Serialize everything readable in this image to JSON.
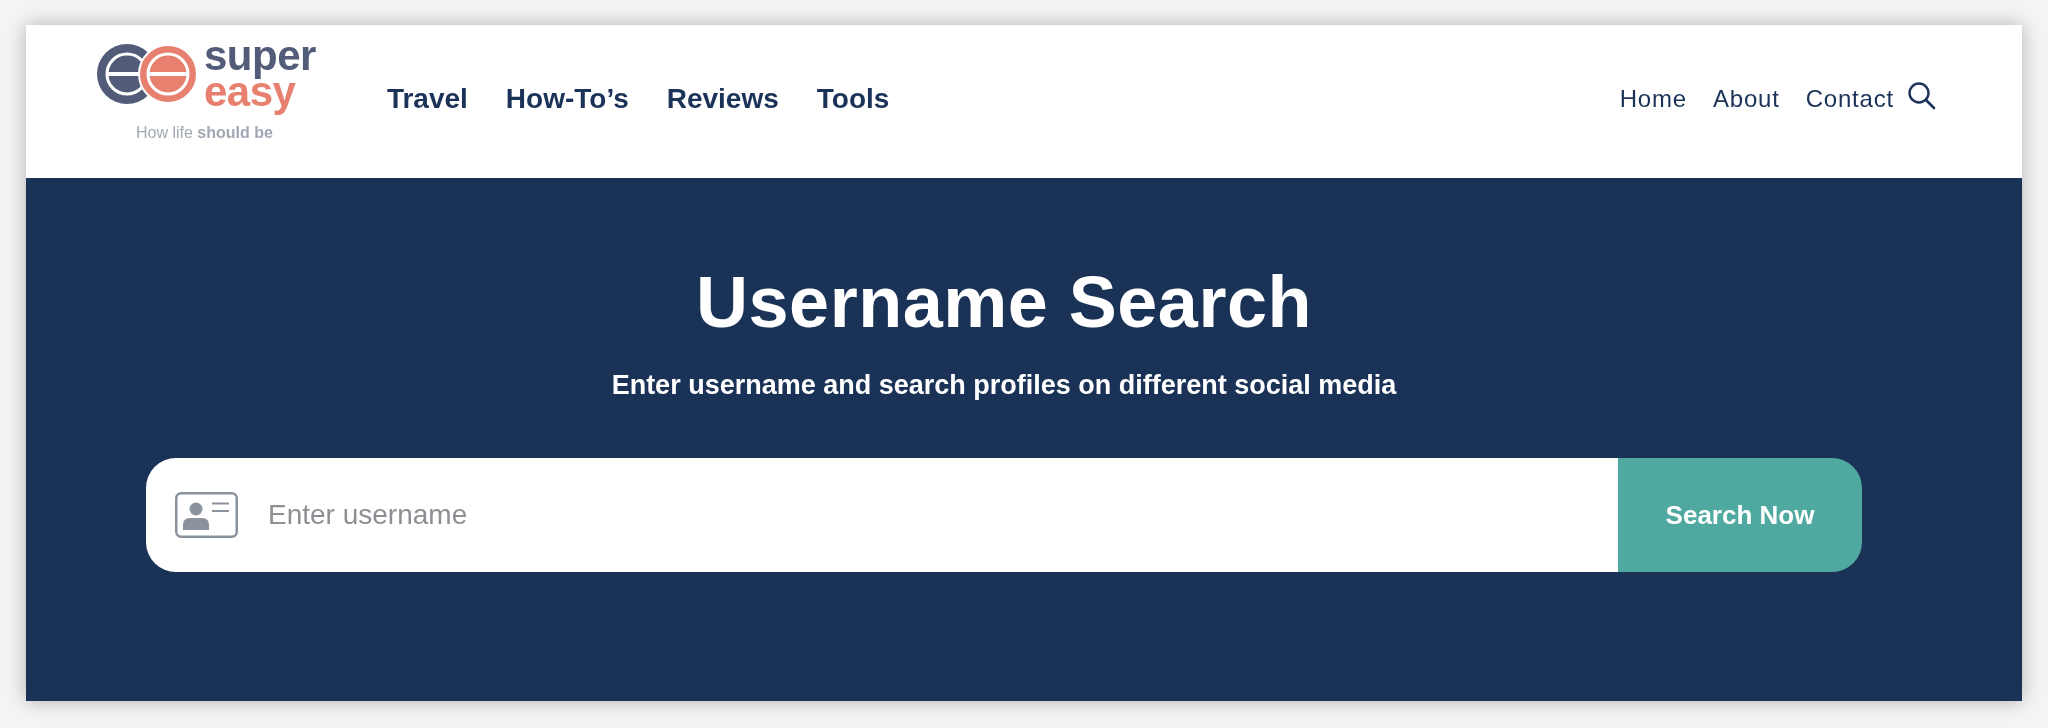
{
  "header": {
    "logo": {
      "wordmark_line_1": "super",
      "wordmark_line_2": "easy",
      "tagline": "How life **should be**"
    },
    "main_nav": [
      {
        "label": "Travel"
      },
      {
        "label": "How-To’s"
      },
      {
        "label": "Reviews"
      },
      {
        "label": "Tools"
      }
    ],
    "utility_nav": [
      {
        "label": "Home"
      },
      {
        "label": "About"
      },
      {
        "label": "Contact"
      }
    ]
  },
  "hero": {
    "title": "Username Search",
    "subtitle": "Enter username and search profiles on different social media",
    "search": {
      "placeholder": "Enter username",
      "button": "Search Now"
    }
  }
}
